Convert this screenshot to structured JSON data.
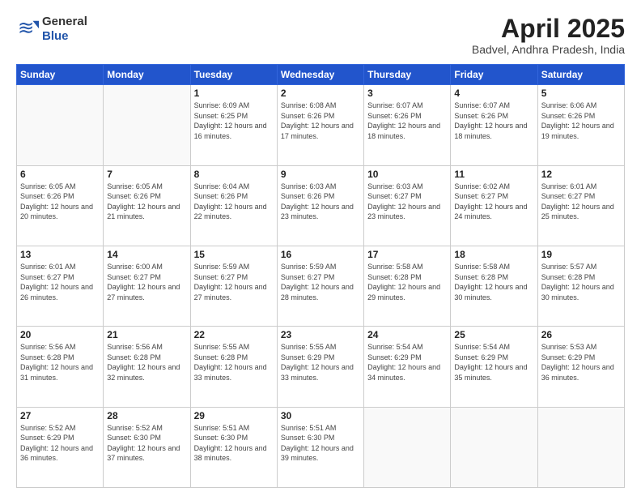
{
  "header": {
    "logo_general": "General",
    "logo_blue": "Blue",
    "month": "April 2025",
    "location": "Badvel, Andhra Pradesh, India"
  },
  "weekdays": [
    "Sunday",
    "Monday",
    "Tuesday",
    "Wednesday",
    "Thursday",
    "Friday",
    "Saturday"
  ],
  "weeks": [
    [
      {
        "day": "",
        "sunrise": "",
        "sunset": "",
        "daylight": ""
      },
      {
        "day": "",
        "sunrise": "",
        "sunset": "",
        "daylight": ""
      },
      {
        "day": "1",
        "sunrise": "Sunrise: 6:09 AM",
        "sunset": "Sunset: 6:25 PM",
        "daylight": "Daylight: 12 hours and 16 minutes."
      },
      {
        "day": "2",
        "sunrise": "Sunrise: 6:08 AM",
        "sunset": "Sunset: 6:26 PM",
        "daylight": "Daylight: 12 hours and 17 minutes."
      },
      {
        "day": "3",
        "sunrise": "Sunrise: 6:07 AM",
        "sunset": "Sunset: 6:26 PM",
        "daylight": "Daylight: 12 hours and 18 minutes."
      },
      {
        "day": "4",
        "sunrise": "Sunrise: 6:07 AM",
        "sunset": "Sunset: 6:26 PM",
        "daylight": "Daylight: 12 hours and 18 minutes."
      },
      {
        "day": "5",
        "sunrise": "Sunrise: 6:06 AM",
        "sunset": "Sunset: 6:26 PM",
        "daylight": "Daylight: 12 hours and 19 minutes."
      }
    ],
    [
      {
        "day": "6",
        "sunrise": "Sunrise: 6:05 AM",
        "sunset": "Sunset: 6:26 PM",
        "daylight": "Daylight: 12 hours and 20 minutes."
      },
      {
        "day": "7",
        "sunrise": "Sunrise: 6:05 AM",
        "sunset": "Sunset: 6:26 PM",
        "daylight": "Daylight: 12 hours and 21 minutes."
      },
      {
        "day": "8",
        "sunrise": "Sunrise: 6:04 AM",
        "sunset": "Sunset: 6:26 PM",
        "daylight": "Daylight: 12 hours and 22 minutes."
      },
      {
        "day": "9",
        "sunrise": "Sunrise: 6:03 AM",
        "sunset": "Sunset: 6:26 PM",
        "daylight": "Daylight: 12 hours and 23 minutes."
      },
      {
        "day": "10",
        "sunrise": "Sunrise: 6:03 AM",
        "sunset": "Sunset: 6:27 PM",
        "daylight": "Daylight: 12 hours and 23 minutes."
      },
      {
        "day": "11",
        "sunrise": "Sunrise: 6:02 AM",
        "sunset": "Sunset: 6:27 PM",
        "daylight": "Daylight: 12 hours and 24 minutes."
      },
      {
        "day": "12",
        "sunrise": "Sunrise: 6:01 AM",
        "sunset": "Sunset: 6:27 PM",
        "daylight": "Daylight: 12 hours and 25 minutes."
      }
    ],
    [
      {
        "day": "13",
        "sunrise": "Sunrise: 6:01 AM",
        "sunset": "Sunset: 6:27 PM",
        "daylight": "Daylight: 12 hours and 26 minutes."
      },
      {
        "day": "14",
        "sunrise": "Sunrise: 6:00 AM",
        "sunset": "Sunset: 6:27 PM",
        "daylight": "Daylight: 12 hours and 27 minutes."
      },
      {
        "day": "15",
        "sunrise": "Sunrise: 5:59 AM",
        "sunset": "Sunset: 6:27 PM",
        "daylight": "Daylight: 12 hours and 27 minutes."
      },
      {
        "day": "16",
        "sunrise": "Sunrise: 5:59 AM",
        "sunset": "Sunset: 6:27 PM",
        "daylight": "Daylight: 12 hours and 28 minutes."
      },
      {
        "day": "17",
        "sunrise": "Sunrise: 5:58 AM",
        "sunset": "Sunset: 6:28 PM",
        "daylight": "Daylight: 12 hours and 29 minutes."
      },
      {
        "day": "18",
        "sunrise": "Sunrise: 5:58 AM",
        "sunset": "Sunset: 6:28 PM",
        "daylight": "Daylight: 12 hours and 30 minutes."
      },
      {
        "day": "19",
        "sunrise": "Sunrise: 5:57 AM",
        "sunset": "Sunset: 6:28 PM",
        "daylight": "Daylight: 12 hours and 30 minutes."
      }
    ],
    [
      {
        "day": "20",
        "sunrise": "Sunrise: 5:56 AM",
        "sunset": "Sunset: 6:28 PM",
        "daylight": "Daylight: 12 hours and 31 minutes."
      },
      {
        "day": "21",
        "sunrise": "Sunrise: 5:56 AM",
        "sunset": "Sunset: 6:28 PM",
        "daylight": "Daylight: 12 hours and 32 minutes."
      },
      {
        "day": "22",
        "sunrise": "Sunrise: 5:55 AM",
        "sunset": "Sunset: 6:28 PM",
        "daylight": "Daylight: 12 hours and 33 minutes."
      },
      {
        "day": "23",
        "sunrise": "Sunrise: 5:55 AM",
        "sunset": "Sunset: 6:29 PM",
        "daylight": "Daylight: 12 hours and 33 minutes."
      },
      {
        "day": "24",
        "sunrise": "Sunrise: 5:54 AM",
        "sunset": "Sunset: 6:29 PM",
        "daylight": "Daylight: 12 hours and 34 minutes."
      },
      {
        "day": "25",
        "sunrise": "Sunrise: 5:54 AM",
        "sunset": "Sunset: 6:29 PM",
        "daylight": "Daylight: 12 hours and 35 minutes."
      },
      {
        "day": "26",
        "sunrise": "Sunrise: 5:53 AM",
        "sunset": "Sunset: 6:29 PM",
        "daylight": "Daylight: 12 hours and 36 minutes."
      }
    ],
    [
      {
        "day": "27",
        "sunrise": "Sunrise: 5:52 AM",
        "sunset": "Sunset: 6:29 PM",
        "daylight": "Daylight: 12 hours and 36 minutes."
      },
      {
        "day": "28",
        "sunrise": "Sunrise: 5:52 AM",
        "sunset": "Sunset: 6:30 PM",
        "daylight": "Daylight: 12 hours and 37 minutes."
      },
      {
        "day": "29",
        "sunrise": "Sunrise: 5:51 AM",
        "sunset": "Sunset: 6:30 PM",
        "daylight": "Daylight: 12 hours and 38 minutes."
      },
      {
        "day": "30",
        "sunrise": "Sunrise: 5:51 AM",
        "sunset": "Sunset: 6:30 PM",
        "daylight": "Daylight: 12 hours and 39 minutes."
      },
      {
        "day": "",
        "sunrise": "",
        "sunset": "",
        "daylight": ""
      },
      {
        "day": "",
        "sunrise": "",
        "sunset": "",
        "daylight": ""
      },
      {
        "day": "",
        "sunrise": "",
        "sunset": "",
        "daylight": ""
      }
    ]
  ]
}
